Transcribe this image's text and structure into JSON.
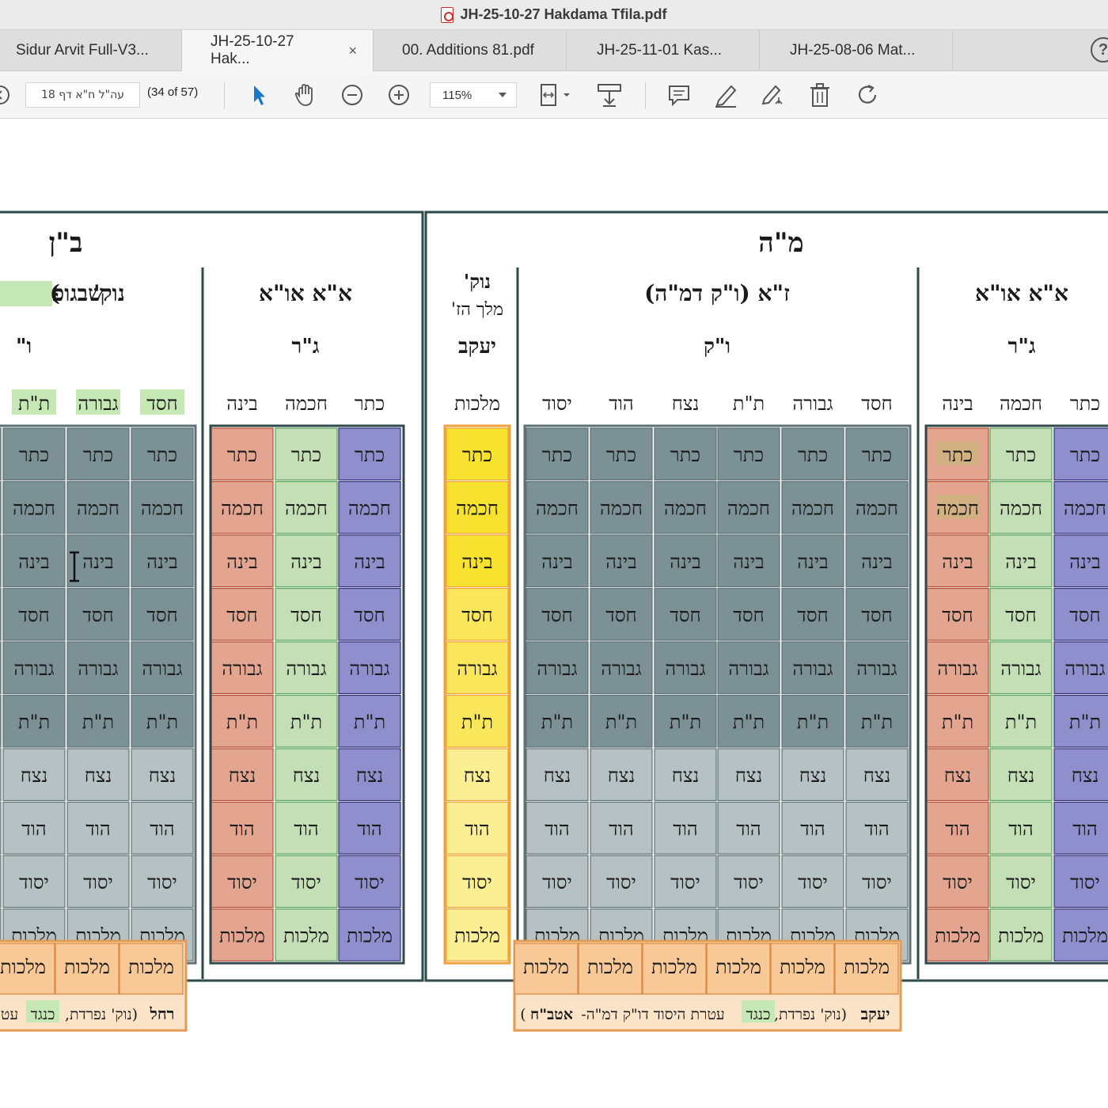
{
  "window": {
    "title": "JH-25-10-27 Hakdama Tfila.pdf"
  },
  "tabs": [
    {
      "label": "Sidur Arvit Full-V3...",
      "active": false
    },
    {
      "label": "JH-25-10-27 Hak...",
      "active": true,
      "close": "×"
    },
    {
      "label": "00. Additions 81.pdf",
      "active": false
    },
    {
      "label": "JH-25-11-01 Kas...",
      "active": false
    },
    {
      "label": "JH-25-08-06 Mat...",
      "active": false
    }
  ],
  "help_label": "?",
  "toolbar": {
    "page_input": "עה\"ל ח\"א דף 18",
    "page_count": "(34 of 57)",
    "zoom": "115%",
    "icons": [
      "prev-page-icon",
      "select-arrow-icon",
      "hand-tool-icon",
      "zoom-out-icon",
      "zoom-in-icon",
      "fit-page-icon",
      "scroll-mode-icon",
      "comment-icon",
      "highlight-pen-icon",
      "sign-icon",
      "delete-icon",
      "rotate-icon"
    ]
  },
  "colors": {
    "frame": "#2f4a48",
    "gray_dark": "#7b9195",
    "gray_light": "#b6c1c4",
    "red": "#e3a58f",
    "green": "#c4dfb6",
    "purple": "#8e8fcc",
    "yellow_bright": "#f7e22f",
    "yellow_light": "#fbee93",
    "orange": "#f8c997",
    "highlight_green": "#c5e8b4"
  },
  "doc": {
    "sections": {
      "right_title": "מ\"ה",
      "left_title": "ב\"ן"
    },
    "column_groups": {
      "aa_right": {
        "title": "א\"א או\"א",
        "sub": "ג\"ר"
      },
      "za": {
        "title": "ז\"א (ו\"ק דמ\"ה)",
        "sub": "ו\"ק"
      },
      "nok_right": {
        "title": "נוק'",
        "title2": "מלך הז'",
        "sub": "יעקב"
      },
      "aa_left": {
        "title": "א\"א או\"א",
        "sub": "ג\"ר"
      },
      "nok_left": {
        "title_prefix": "נוק'",
        "paren": "(",
        "highlight": "שבגופ",
        "sub": "ו\""
      }
    },
    "col_headers": {
      "aa_right": [
        "כתר",
        "חכמה",
        "בינה"
      ],
      "za": [
        "חסד",
        "גבורה",
        "ת\"ת",
        "נצח",
        "הוד",
        "יסוד"
      ],
      "nok_right": [
        "מלכות"
      ],
      "aa_left": [
        "כתר",
        "חכמה",
        "בינה"
      ],
      "nok_left": [
        "חסד",
        "גבורה",
        "ת\"ת"
      ]
    },
    "sefirot": [
      "כתר",
      "חכמה",
      "בינה",
      "חסד",
      "גבורה",
      "ת\"ת",
      "נצח",
      "הוד",
      "יסוד",
      "מלכות"
    ],
    "malchut_label": "מלכות",
    "yaakov_note": {
      "bold": "יעקב",
      "part1": "(נוק' נפרדת,",
      "highlight": "כנגד",
      "part2": "עטרת היסוד דו\"ק דמ\"ה-",
      "bold2": "אטב\"ח",
      "close": ")"
    },
    "rachel_note": {
      "bold": "רחל",
      "part1": "(נוק' נפרדת,",
      "highlight": "כנגד",
      "part2": "עט"
    }
  }
}
